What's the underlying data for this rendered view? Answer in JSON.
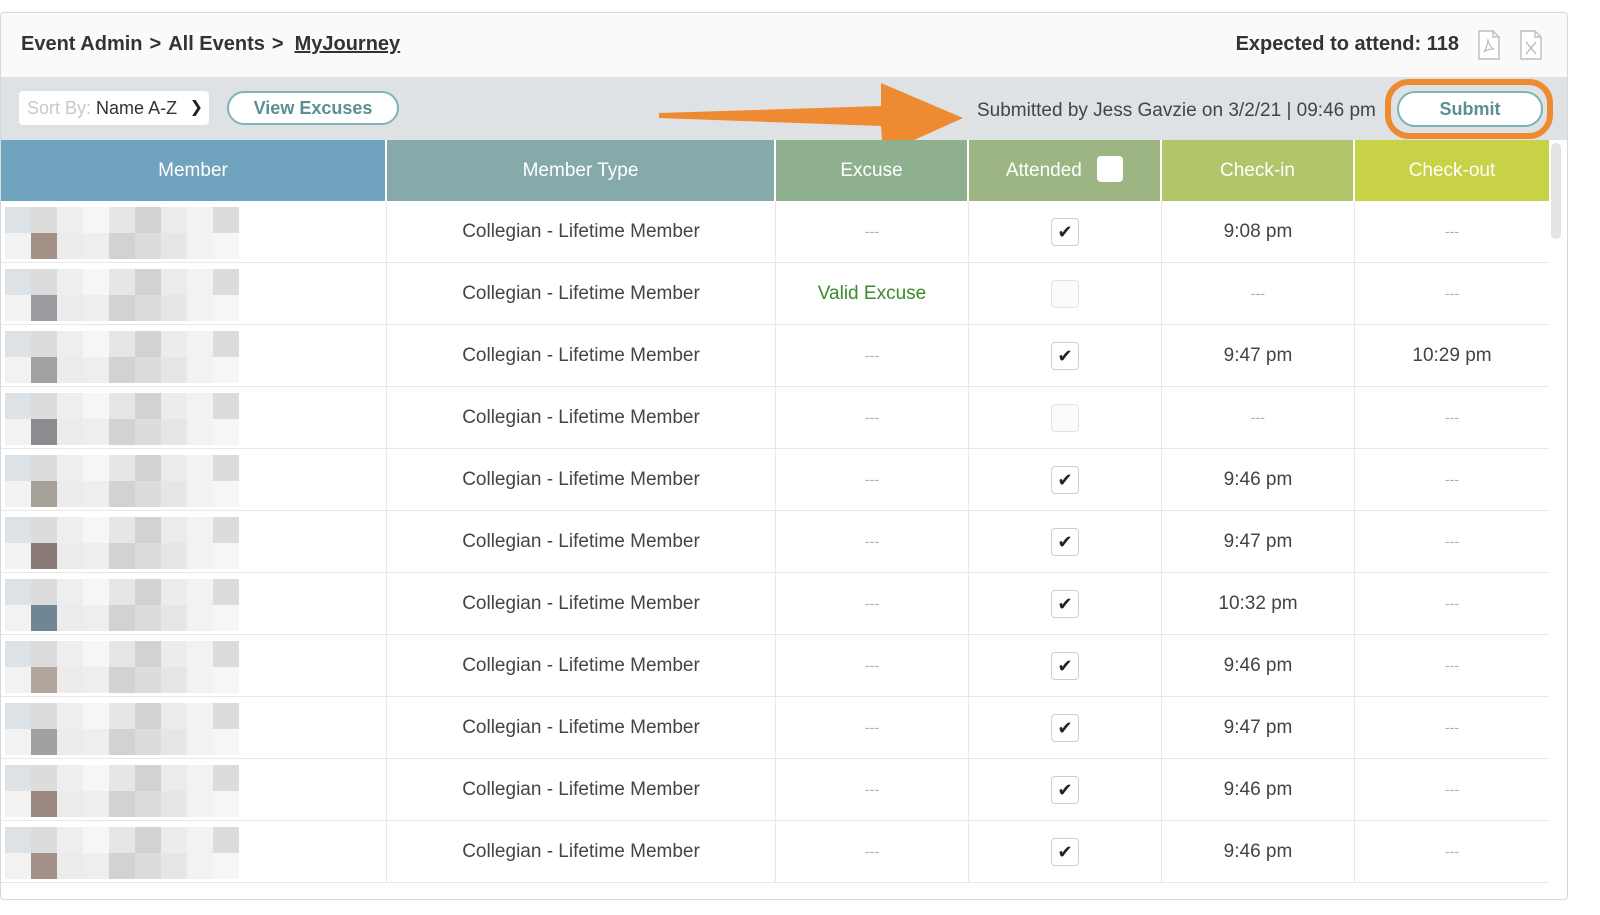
{
  "header": {
    "breadcrumb": [
      "Event Admin",
      "All Events",
      "MyJourney"
    ],
    "expected_label": "Expected to attend: 118",
    "icons": [
      "pdf-export-icon",
      "excel-export-icon"
    ]
  },
  "toolbar": {
    "sort_prefix": "Sort By:",
    "sort_value": "Name A-Z",
    "view_excuses_label": "View Excuses",
    "submitted_text": "Submitted by Jess Gavzie on 3/2/21  |  09:46 pm",
    "submit_label": "Submit"
  },
  "colors": {
    "accent_arrow": "#ee8a32",
    "button_text": "#5a8f95",
    "valid_excuse": "#3a8a2a"
  },
  "table": {
    "columns": [
      "Member",
      "Member Type",
      "Excuse",
      "Attended",
      "Check-in",
      "Check-out"
    ],
    "rows": [
      {
        "type": "Collegian - Lifetime Member",
        "excuse": "---",
        "attended": true,
        "checkin": "9:08 pm",
        "checkout": "---"
      },
      {
        "type": "Collegian - Lifetime Member",
        "excuse": "Valid Excuse",
        "attended": false,
        "checkin": "---",
        "checkout": "---"
      },
      {
        "type": "Collegian - Lifetime Member",
        "excuse": "---",
        "attended": true,
        "checkin": "9:47 pm",
        "checkout": "10:29 pm"
      },
      {
        "type": "Collegian - Lifetime Member",
        "excuse": "---",
        "attended": false,
        "checkin": "---",
        "checkout": "---"
      },
      {
        "type": "Collegian - Lifetime Member",
        "excuse": "---",
        "attended": true,
        "checkin": "9:46 pm",
        "checkout": "---"
      },
      {
        "type": "Collegian - Lifetime Member",
        "excuse": "---",
        "attended": true,
        "checkin": "9:47 pm",
        "checkout": "---"
      },
      {
        "type": "Collegian - Lifetime Member",
        "excuse": "---",
        "attended": true,
        "checkin": "10:32 pm",
        "checkout": "---"
      },
      {
        "type": "Collegian - Lifetime Member",
        "excuse": "---",
        "attended": true,
        "checkin": "9:46 pm",
        "checkout": "---"
      },
      {
        "type": "Collegian - Lifetime Member",
        "excuse": "---",
        "attended": true,
        "checkin": "9:47 pm",
        "checkout": "---"
      },
      {
        "type": "Collegian - Lifetime Member",
        "excuse": "---",
        "attended": true,
        "checkin": "9:46 pm",
        "checkout": "---"
      },
      {
        "type": "Collegian - Lifetime Member",
        "excuse": "---",
        "attended": true,
        "checkin": "9:46 pm",
        "checkout": "---"
      }
    ]
  }
}
